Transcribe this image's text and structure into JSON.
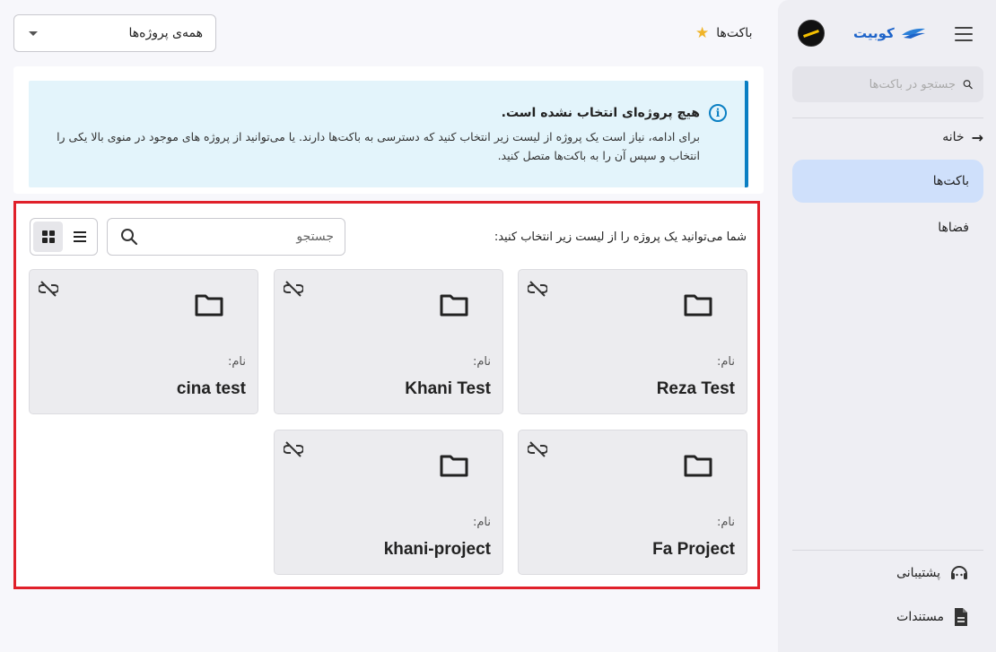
{
  "sidebar": {
    "brand": "کوبیت",
    "search_placeholder": "جستجو در باکت‌ها",
    "home_label": "خانه",
    "items": [
      {
        "label": "باکت‌ها",
        "active": true
      },
      {
        "label": "فضاها",
        "active": false
      }
    ],
    "footer": {
      "support_label": "پشتیبانی",
      "docs_label": "مستندات"
    }
  },
  "header": {
    "title": "باکت‌ها",
    "project_select_value": "همه‌ی پروژه‌ها"
  },
  "alert": {
    "title": "هیچ پروژه‌ای انتخاب نشده است.",
    "body": "برای ادامه، نیاز است یک پروژه از لیست زیر انتخاب کنید که دسترسی به باکت‌ها دارند. یا می‌توانید از پروژه های موجود در منوی بالا یکی را انتخاب و سپس آن را به باکت‌ها متصل کنید."
  },
  "panel": {
    "label": "شما می‌توانید یک پروژه را از لیست زیر انتخاب کنید:",
    "search_placeholder": "جستجو",
    "name_label": "نام:",
    "projects": [
      {
        "name": "Reza Test"
      },
      {
        "name": "Khani Test"
      },
      {
        "name": "cina test"
      },
      {
        "name": "Fa Project"
      },
      {
        "name": "khani-project"
      }
    ]
  },
  "colors": {
    "accent": "#1d63c9",
    "alert_border": "#0a7fc3",
    "highlight_border": "#e0202a",
    "active_nav": "#cfe0fb"
  }
}
